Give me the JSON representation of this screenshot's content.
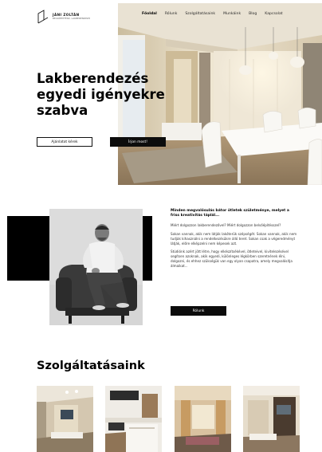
{
  "brand": {
    "name": "JÁNI ZOLTÁN",
    "tagline": "BELSŐÉPÍTÉSZ, LAKBERENDEZŐ"
  },
  "nav": {
    "items": [
      {
        "label": "Főoldal",
        "active": true
      },
      {
        "label": "Rólunk",
        "active": false
      },
      {
        "label": "Szolgáltatásaink",
        "active": false
      },
      {
        "label": "Munkáink",
        "active": false
      },
      {
        "label": "Blog",
        "active": false
      },
      {
        "label": "Kapcsolat",
        "active": false
      }
    ]
  },
  "hero": {
    "title": "Lakberendezés egyedi igényekre szabva",
    "primary_button": "Ajánlatot kérek",
    "secondary_button": "Írjon most!"
  },
  "about": {
    "lead": "Minden megvalósulás bátor ötletek születménye, melyet a friss kreativitás táplál...",
    "paragraphs": [
      "Miért dolgozzon lakberendezővel? Miért dolgozzon belsőépítésszel?",
      "Sokan vannak, akik nem látják lakóterük szépségét. Sokan vannak, akik nem tudják kihasználni a rendelkezésükre álló teret. Sokan csak a végeredményt látják, előre elképzelni nem képesek azt.",
      "Stúdiónk azért jött létre, hogy elkészítsékével, ötleteivel, kivitelezésével segítsen azoknak, akik egyedi, különleges légkörben szeretnének élni, dolgozni, és ehhez szükségük van egy olyan csapatra, amely megvalósítja álmaikat..."
    ],
    "button": "Rólunk"
  },
  "services": {
    "title": "Szolgáltatásaink"
  },
  "colors": {
    "accent": "#0c0c0c",
    "background": "#ffffff"
  }
}
